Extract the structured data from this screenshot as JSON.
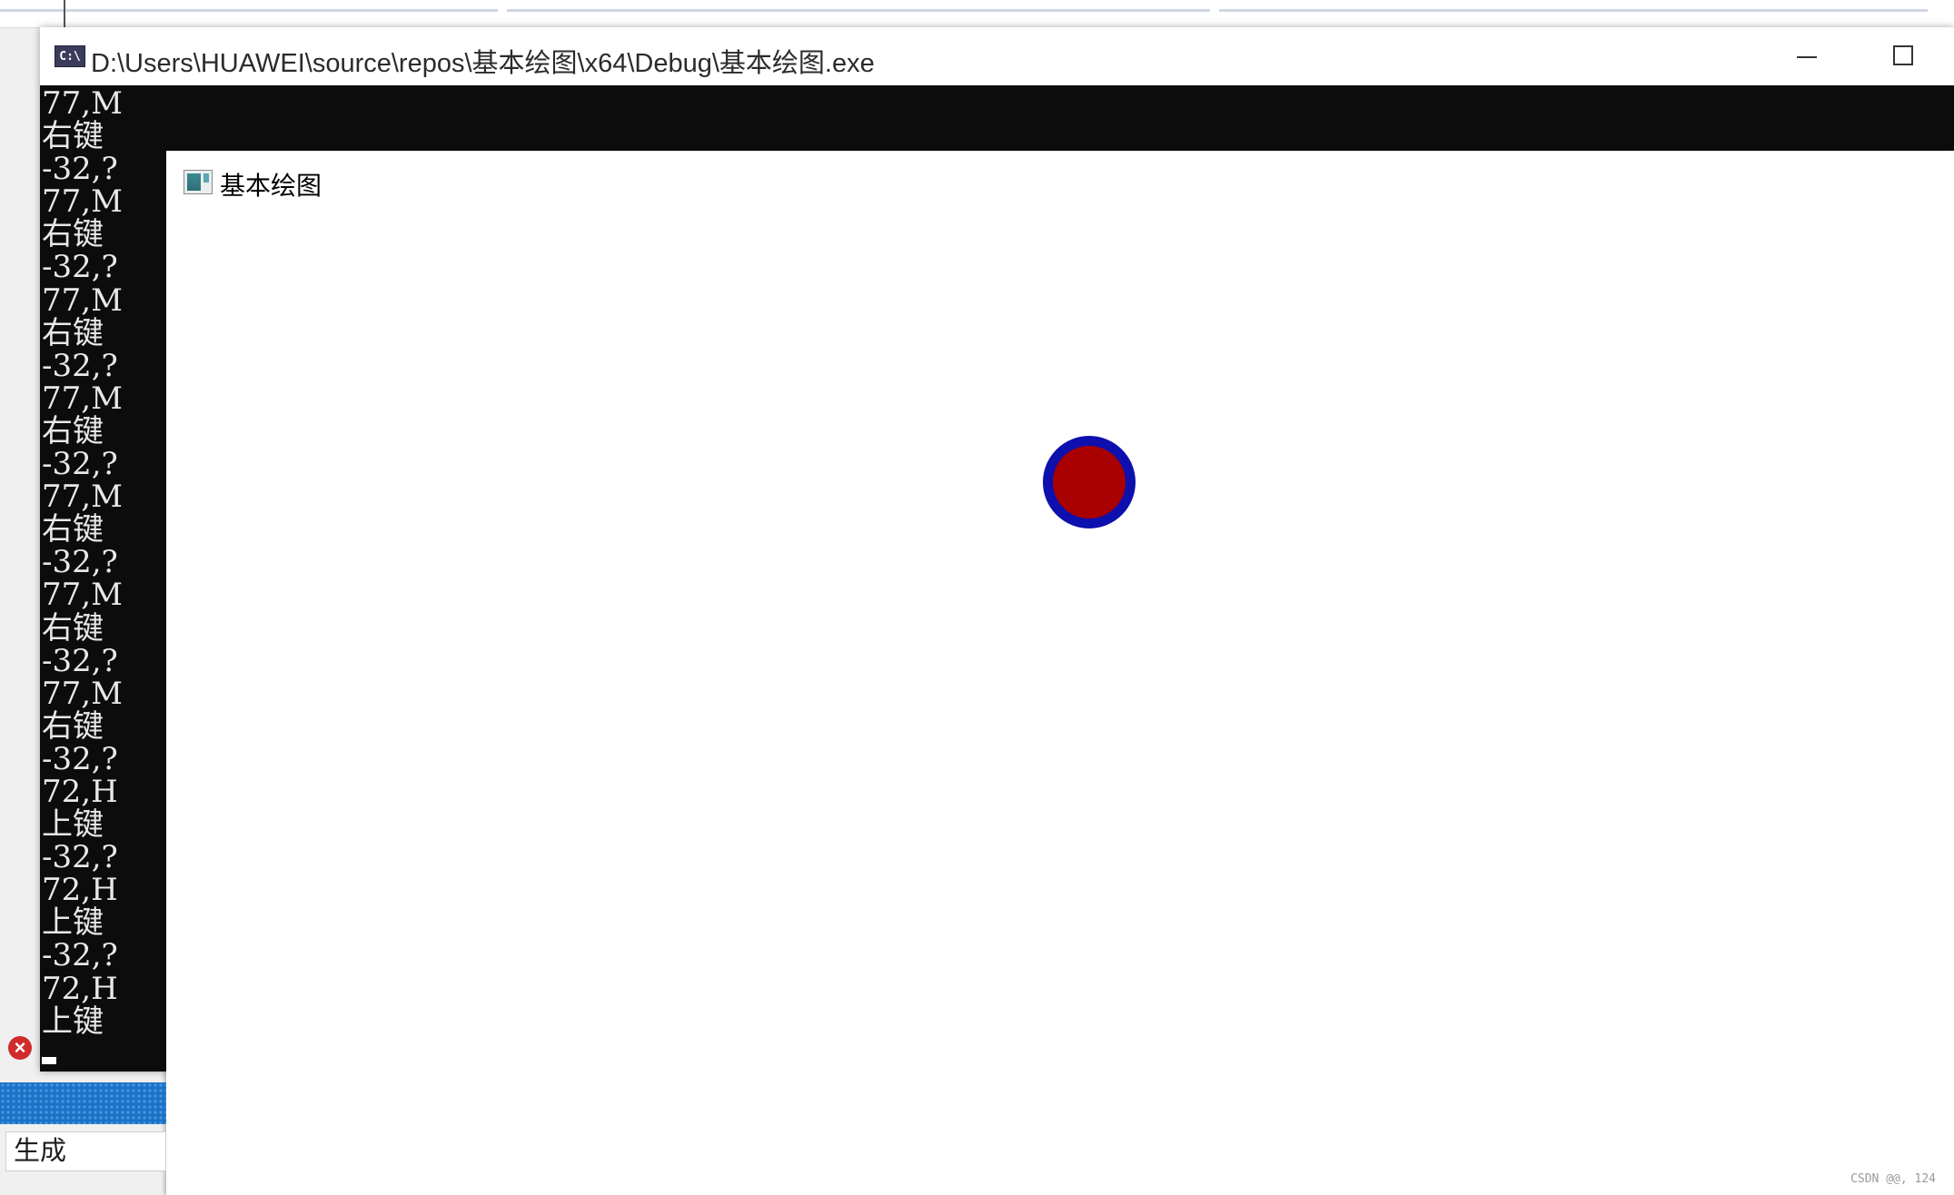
{
  "console_window": {
    "title": "D:\\Users\\HUAWEI\\source\\repos\\基本绘图\\x64\\Debug\\基本绘图.exe",
    "icon_label": "C:\\",
    "lines": [
      "77,M",
      "右键",
      "-32,?",
      "77,M",
      "右键",
      "-32,?",
      "77,M",
      "右键",
      "-32,?",
      "77,M",
      "右键",
      "-32,?",
      "77,M",
      "右键",
      "-32,?",
      "77,M",
      "右键",
      "-32,?",
      "77,M",
      "右键",
      "-32,?",
      "72,H",
      "上键",
      "-32,?",
      "72,H",
      "上键",
      "-32,?",
      "72,H",
      "上键"
    ]
  },
  "graphics_window": {
    "title": "基本绘图",
    "circle": {
      "fill_color": "#a90000",
      "border_color": "#0d10ad"
    }
  },
  "ide": {
    "output_tab_label": "生成",
    "error_icon": "error-icon",
    "accent_color": "#1b73c9"
  },
  "watermark": "CSDN @@, 124"
}
